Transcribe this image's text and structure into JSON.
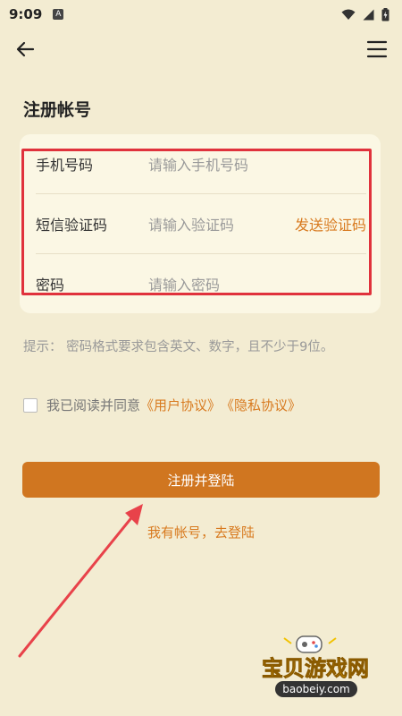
{
  "status_bar": {
    "time": "9:09",
    "a_badge": "A"
  },
  "page": {
    "title": "注册帐号"
  },
  "form": {
    "phone": {
      "label": "手机号码",
      "placeholder": "请输入手机号码"
    },
    "sms": {
      "label": "短信验证码",
      "placeholder": "请输入验证码",
      "send_label": "发送验证码"
    },
    "password": {
      "label": "密码",
      "placeholder": "请输入密码"
    }
  },
  "hint": "提示： 密码格式要求包含英文、数字，且不少于9位。",
  "agreement": {
    "prefix": "我已阅读并同意",
    "user_agreement": "《用户协议》",
    "privacy_policy": "《隐私协议》",
    "checked": false
  },
  "submit_label": "注册并登陆",
  "login_link": "我有帐号，去登陆",
  "watermark": {
    "title": "宝贝游戏网",
    "url": "baobeiy.com"
  },
  "colors": {
    "accent": "#d07620",
    "highlight": "#e0323c",
    "background": "#f3ecd2"
  }
}
